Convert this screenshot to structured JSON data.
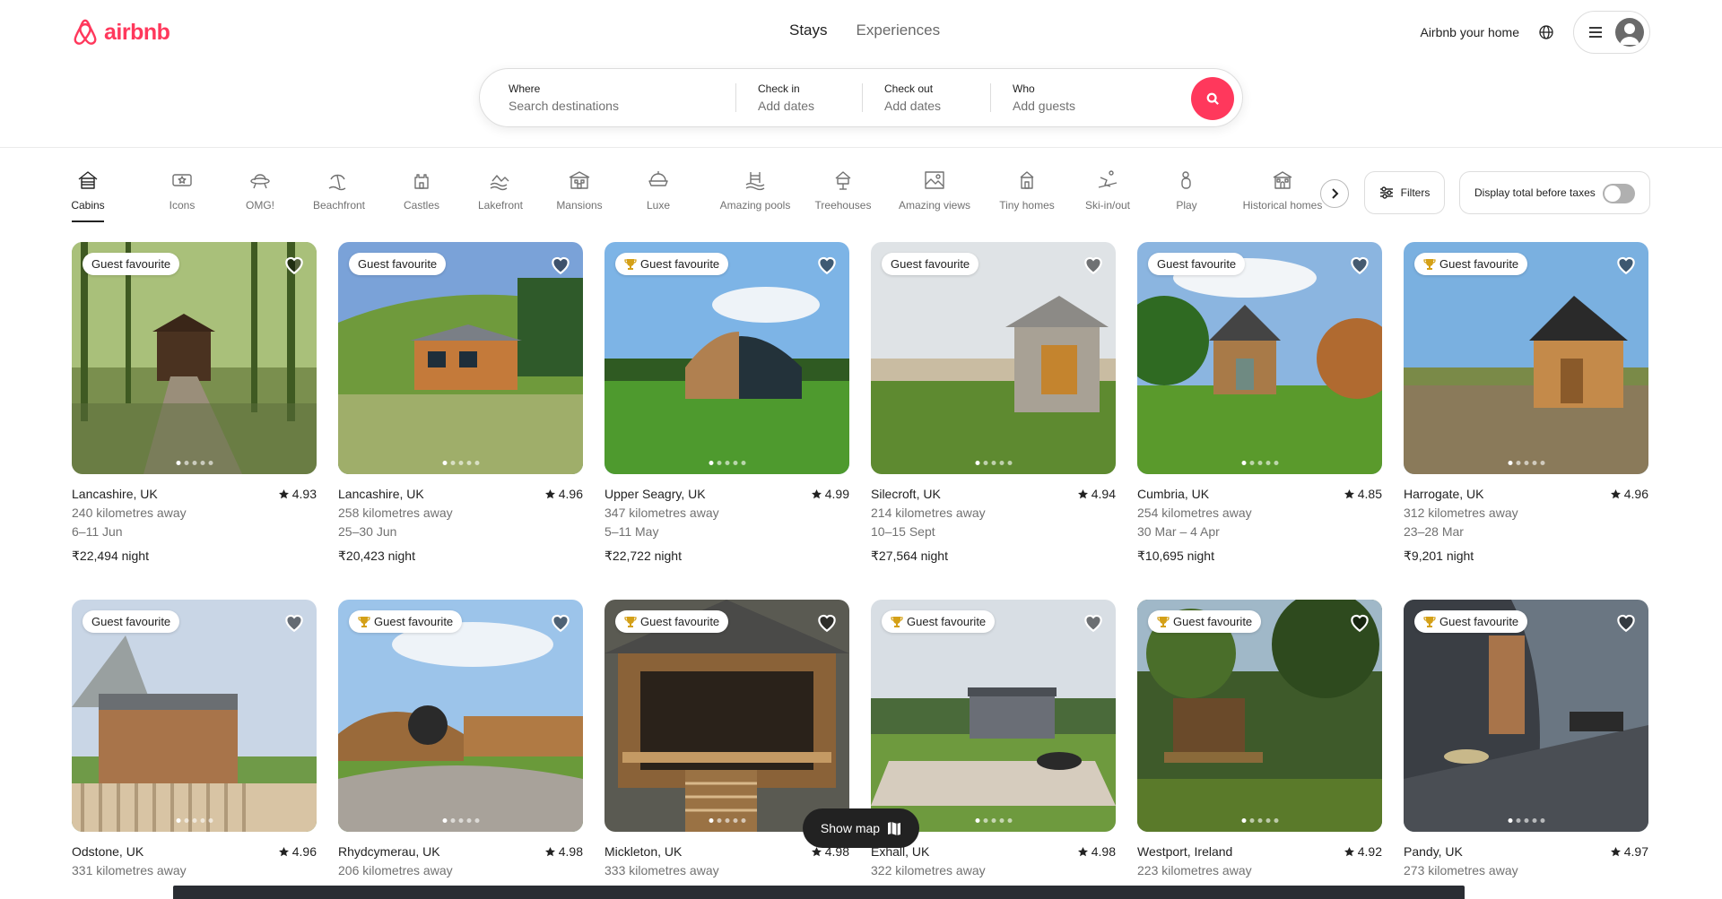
{
  "brand": {
    "name": "airbnb",
    "color": "#ff385c"
  },
  "nav": {
    "tabs": [
      {
        "label": "Stays"
      },
      {
        "label": "Experiences"
      }
    ],
    "host_link": "Airbnb your home"
  },
  "search": {
    "where": {
      "label": "Where",
      "placeholder": "Search destinations"
    },
    "checkin": {
      "label": "Check in",
      "placeholder": "Add dates"
    },
    "checkout": {
      "label": "Check out",
      "placeholder": "Add dates"
    },
    "who": {
      "label": "Who",
      "placeholder": "Add guests"
    }
  },
  "categories": [
    {
      "label": "Cabins",
      "icon": "cabin-icon"
    },
    {
      "label": "Icons",
      "icon": "icons-ticket-icon"
    },
    {
      "label": "OMG!",
      "icon": "ufo-icon"
    },
    {
      "label": "Beachfront",
      "icon": "beach-icon"
    },
    {
      "label": "Castles",
      "icon": "castle-icon"
    },
    {
      "label": "Lakefront",
      "icon": "lakefront-icon"
    },
    {
      "label": "Mansions",
      "icon": "mansion-icon"
    },
    {
      "label": "Luxe",
      "icon": "luxe-icon"
    },
    {
      "label": "Amazing pools",
      "icon": "pool-icon"
    },
    {
      "label": "Treehouses",
      "icon": "treehouse-icon"
    },
    {
      "label": "Amazing views",
      "icon": "views-icon"
    },
    {
      "label": "Tiny homes",
      "icon": "tiny-home-icon"
    },
    {
      "label": "Ski-in/out",
      "icon": "ski-icon"
    },
    {
      "label": "Play",
      "icon": "play-icon"
    },
    {
      "label": "Historical homes",
      "icon": "historical-home-icon"
    }
  ],
  "filters_label": "Filters",
  "taxes_label": "Display total before taxes",
  "badge_label": "Guest favourite",
  "listings": [
    {
      "location": "Lancashire, UK",
      "rating": "4.93",
      "distance": "240 kilometres away",
      "dates": "6–11 Jun",
      "price": "₹22,494 night",
      "trophy": false
    },
    {
      "location": "Lancashire, UK",
      "rating": "4.96",
      "distance": "258 kilometres away",
      "dates": "25–30 Jun",
      "price": "₹20,423 night",
      "trophy": false
    },
    {
      "location": "Upper Seagry, UK",
      "rating": "4.99",
      "distance": "347 kilometres away",
      "dates": "5–11 May",
      "price": "₹22,722 night",
      "trophy": true
    },
    {
      "location": "Silecroft, UK",
      "rating": "4.94",
      "distance": "214 kilometres away",
      "dates": "10–15 Sept",
      "price": "₹27,564 night",
      "trophy": false
    },
    {
      "location": "Cumbria, UK",
      "rating": "4.85",
      "distance": "254 kilometres away",
      "dates": "30 Mar – 4 Apr",
      "price": "₹10,695 night",
      "trophy": false
    },
    {
      "location": "Harrogate, UK",
      "rating": "4.96",
      "distance": "312 kilometres away",
      "dates": "23–28 Mar",
      "price": "₹9,201 night",
      "trophy": true
    },
    {
      "location": "Odstone, UK",
      "rating": "4.96",
      "distance": "331 kilometres away",
      "dates": "",
      "price": "",
      "trophy": false
    },
    {
      "location": "Rhydcymerau, UK",
      "rating": "4.98",
      "distance": "206 kilometres away",
      "dates": "",
      "price": "",
      "trophy": true
    },
    {
      "location": "Mickleton, UK",
      "rating": "4.98",
      "distance": "333 kilometres away",
      "dates": "",
      "price": "",
      "trophy": true
    },
    {
      "location": "Exhall, UK",
      "rating": "4.98",
      "distance": "322 kilometres away",
      "dates": "",
      "price": "",
      "trophy": true
    },
    {
      "location": "Westport, Ireland",
      "rating": "4.92",
      "distance": "223 kilometres away",
      "dates": "",
      "price": "",
      "trophy": true
    },
    {
      "location": "Pandy, UK",
      "rating": "4.97",
      "distance": "273 kilometres away",
      "dates": "",
      "price": "",
      "trophy": true
    }
  ],
  "show_map_label": "Show map"
}
